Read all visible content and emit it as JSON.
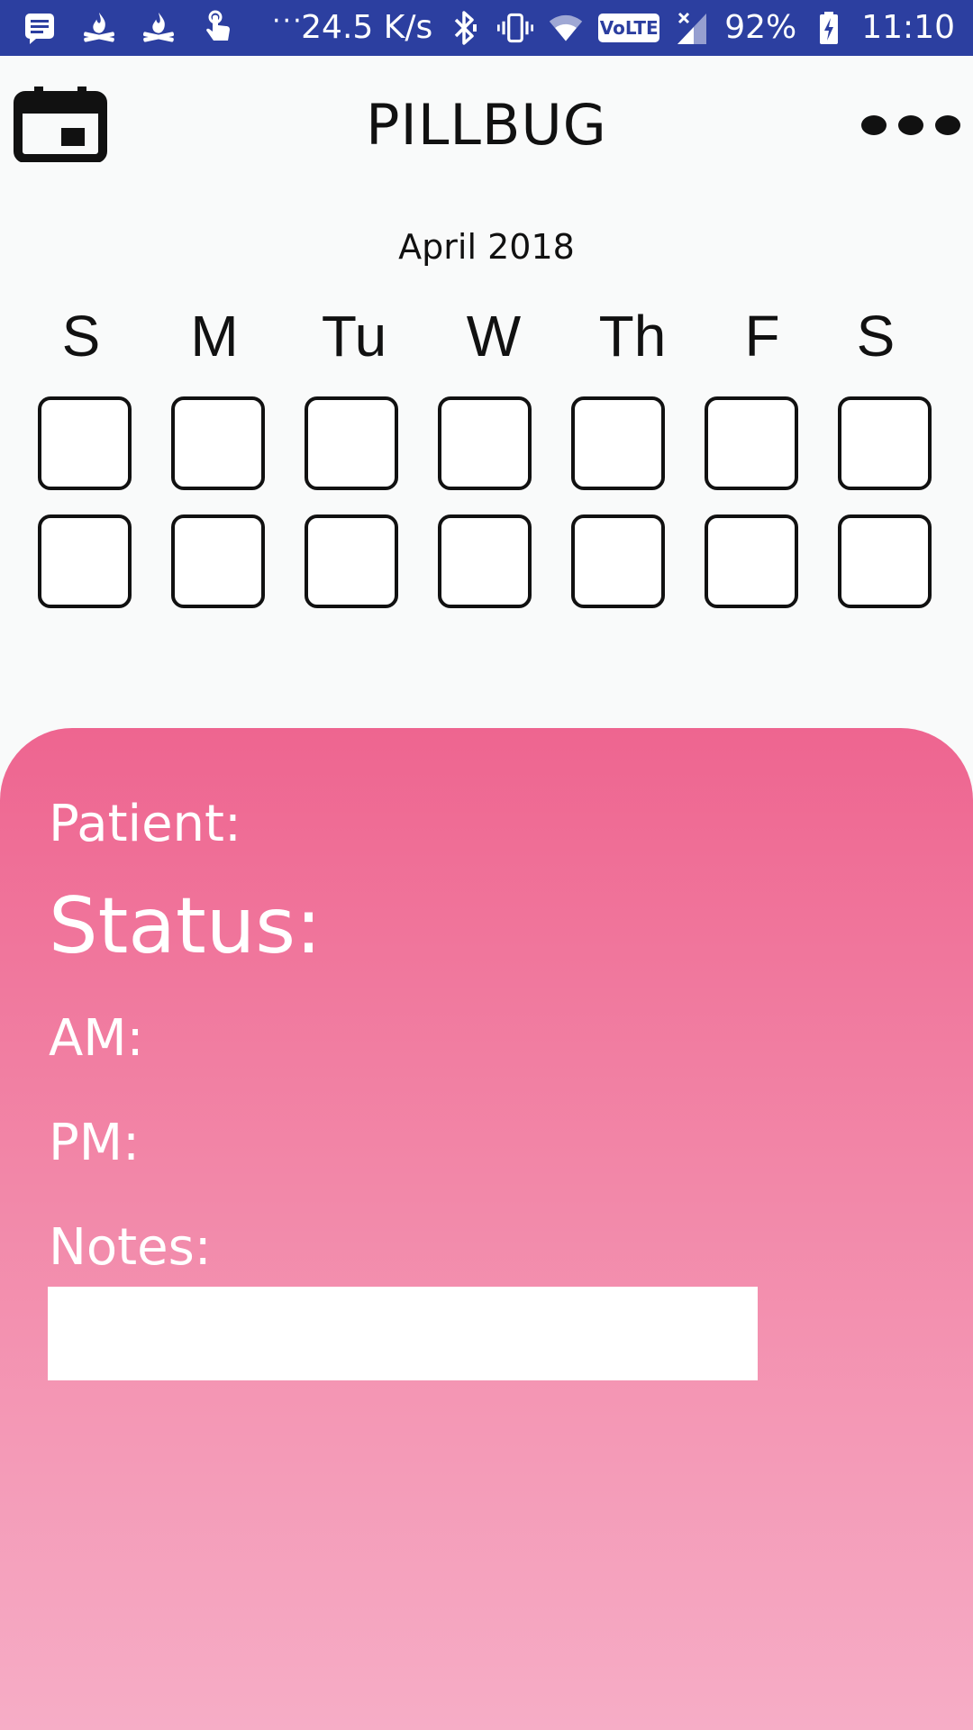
{
  "status_bar": {
    "network_speed": "24.5 K/s",
    "volte_label": "VoLTE",
    "battery_percent": "92%",
    "time": "11:10",
    "overflow_dots": "···",
    "left_icons": [
      "message-icon",
      "fire-icon",
      "fire-icon",
      "touch-icon"
    ],
    "right_icons": [
      "bluetooth-icon",
      "vibrate-icon",
      "wifi-icon",
      "volte-icon",
      "signal-icon",
      "battery-charging-icon"
    ]
  },
  "app_bar": {
    "title": "PILLBUG",
    "left_icon": "calendar-icon",
    "right_icon": "more-options-icon"
  },
  "calendar": {
    "month": "April 2018",
    "weekdays": [
      "S",
      "M",
      "Tu",
      "W",
      "Th",
      "F",
      "S"
    ],
    "rows": 2
  },
  "details": {
    "patient_label": "Patient:",
    "status_label": "Status:",
    "am_label": "AM:",
    "pm_label": "PM:",
    "notes_label": "Notes:",
    "notes_value": ""
  },
  "colors": {
    "status_bar": "#2c3fa0",
    "background": "#f9fafa",
    "panel_top": "#ee6590",
    "panel_bottom": "#f6adc6"
  }
}
